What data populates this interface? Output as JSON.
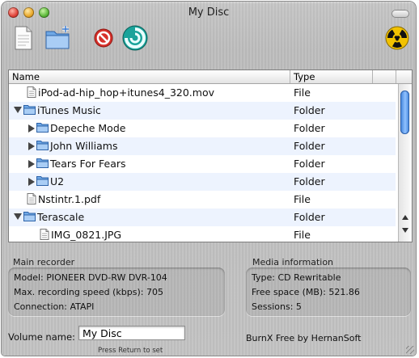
{
  "window": {
    "title": "My Disc"
  },
  "toolbar": {
    "icons": [
      "new-document-icon",
      "new-folder-icon",
      "cancel-icon",
      "burn-icon",
      "radiation-icon"
    ]
  },
  "list": {
    "columns": {
      "name": "Name",
      "type": "Type"
    },
    "rows": [
      {
        "name": "iPod-ad-hip_hop+itunes4_320.mov",
        "type": "File",
        "kind": "file",
        "depth": 0,
        "disclosure": "none"
      },
      {
        "name": "iTunes Music",
        "type": "Folder",
        "kind": "folder",
        "depth": 0,
        "disclosure": "expanded"
      },
      {
        "name": "Depeche Mode",
        "type": "Folder",
        "kind": "folder",
        "depth": 1,
        "disclosure": "collapsed"
      },
      {
        "name": "John Williams",
        "type": "Folder",
        "kind": "folder",
        "depth": 1,
        "disclosure": "collapsed"
      },
      {
        "name": "Tears For Fears",
        "type": "Folder",
        "kind": "folder",
        "depth": 1,
        "disclosure": "collapsed"
      },
      {
        "name": "U2",
        "type": "Folder",
        "kind": "folder",
        "depth": 1,
        "disclosure": "collapsed"
      },
      {
        "name": "Nstintr.1.pdf",
        "type": "File",
        "kind": "file",
        "depth": 0,
        "disclosure": "none"
      },
      {
        "name": "Terascale",
        "type": "Folder",
        "kind": "folder",
        "depth": 0,
        "disclosure": "expanded"
      },
      {
        "name": "IMG_0821.JPG",
        "type": "File",
        "kind": "file",
        "depth": 1,
        "disclosure": "none"
      }
    ]
  },
  "recorder": {
    "heading": "Main recorder",
    "model": "Model:  PIONEER DVD-RW DVR-104",
    "speed": "Max. recording speed (kbps):  705",
    "connection": "Connection:  ATAPI"
  },
  "media": {
    "heading": "Media information",
    "type": "Type:  CD Rewritable",
    "free": "Free space (MB):  521.86",
    "sessions": "Sessions:  5"
  },
  "volume": {
    "label": "Volume name:",
    "value": "My Disc",
    "hint": "Press Return to set"
  },
  "credit": "BurnX Free by HernanSoft",
  "colors": {
    "selection_stripe": "#edf3fe",
    "scroll_thumb": "#3c7fd8"
  }
}
